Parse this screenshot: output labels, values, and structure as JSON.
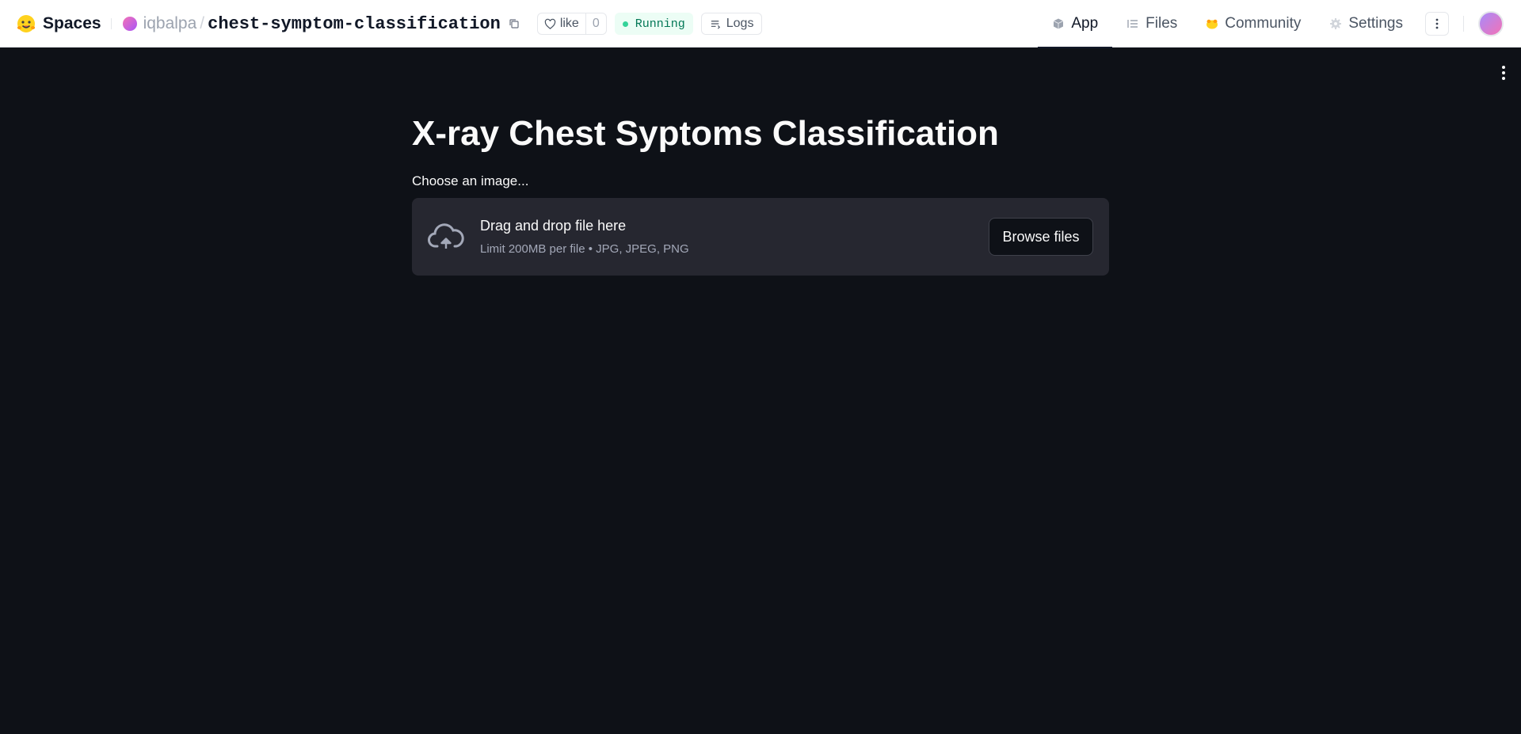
{
  "header": {
    "brand": "Spaces",
    "owner": "iqbalpa",
    "separator": "/",
    "repo_name": "chest-symptom-classification",
    "like_label": "like",
    "like_count": "0",
    "status": "Running",
    "logs_label": "Logs",
    "tabs": [
      {
        "label": "App",
        "icon": "app-cube-icon",
        "active": true
      },
      {
        "label": "Files",
        "icon": "files-icon",
        "active": false
      },
      {
        "label": "Community",
        "icon": "community-hf-icon",
        "active": false
      },
      {
        "label": "Settings",
        "icon": "gear-icon",
        "active": false
      }
    ]
  },
  "app": {
    "title": "X-ray Chest Syptoms Classification",
    "uploader": {
      "label": "Choose an image...",
      "drop_text": "Drag and drop file here",
      "limit_text": "Limit 200MB per file • JPG, JPEG, PNG",
      "browse_label": "Browse files"
    }
  },
  "colors": {
    "app_background": "#0e1117",
    "dropzone_background": "#262730",
    "running_text": "#047857",
    "running_background": "#ecfdf5"
  }
}
